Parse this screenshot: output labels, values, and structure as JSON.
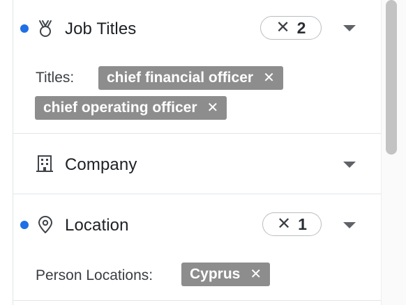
{
  "filters": {
    "job_titles": {
      "title": "Job Titles",
      "icon": "medal-icon",
      "active": true,
      "count_clear_glyph": "✕",
      "count": "2",
      "field_label": "Titles:",
      "tags": [
        {
          "text": "chief financial officer",
          "remove_glyph": "✕"
        },
        {
          "text": "chief operating officer",
          "remove_glyph": "✕"
        }
      ]
    },
    "company": {
      "title": "Company",
      "icon": "building-icon",
      "active": false
    },
    "location": {
      "title": "Location",
      "icon": "map-pin-icon",
      "active": true,
      "count_clear_glyph": "✕",
      "count": "1",
      "field_label": "Person Locations:",
      "tags": [
        {
          "text": "Cyprus",
          "remove_glyph": "✕"
        }
      ]
    }
  },
  "colors": {
    "active_dot": "#1f6fe5",
    "tag_bg": "#8d8d8d",
    "divider": "#e3e5e8"
  }
}
